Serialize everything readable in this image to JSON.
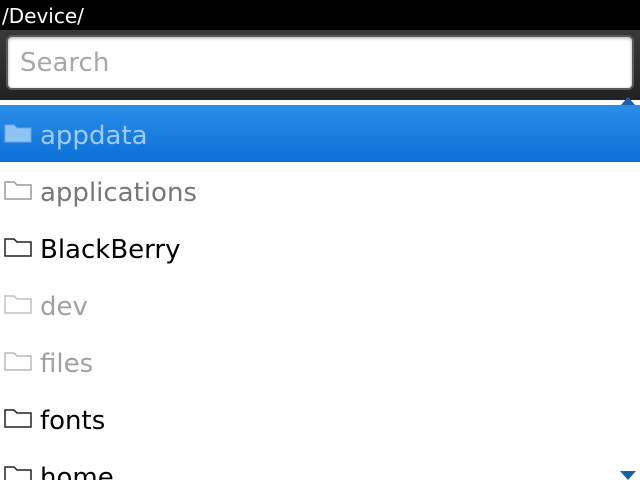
{
  "header": {
    "path": "/Device/"
  },
  "search": {
    "placeholder": "Search",
    "value": ""
  },
  "colors": {
    "selection": "#0b70d6",
    "titlebar": "#000000"
  },
  "folders": [
    {
      "label": "appdata",
      "icon": "folder-icon",
      "state": "selected"
    },
    {
      "label": "applications",
      "icon": "folder-icon",
      "state": "lightish"
    },
    {
      "label": "BlackBerry",
      "icon": "folder-icon",
      "state": "dark"
    },
    {
      "label": "dev",
      "icon": "folder-icon",
      "state": "faded"
    },
    {
      "label": "files",
      "icon": "folder-icon",
      "state": "faded"
    },
    {
      "label": "fonts",
      "icon": "folder-icon",
      "state": "dark"
    },
    {
      "label": "home",
      "icon": "folder-icon",
      "state": "dark"
    }
  ]
}
